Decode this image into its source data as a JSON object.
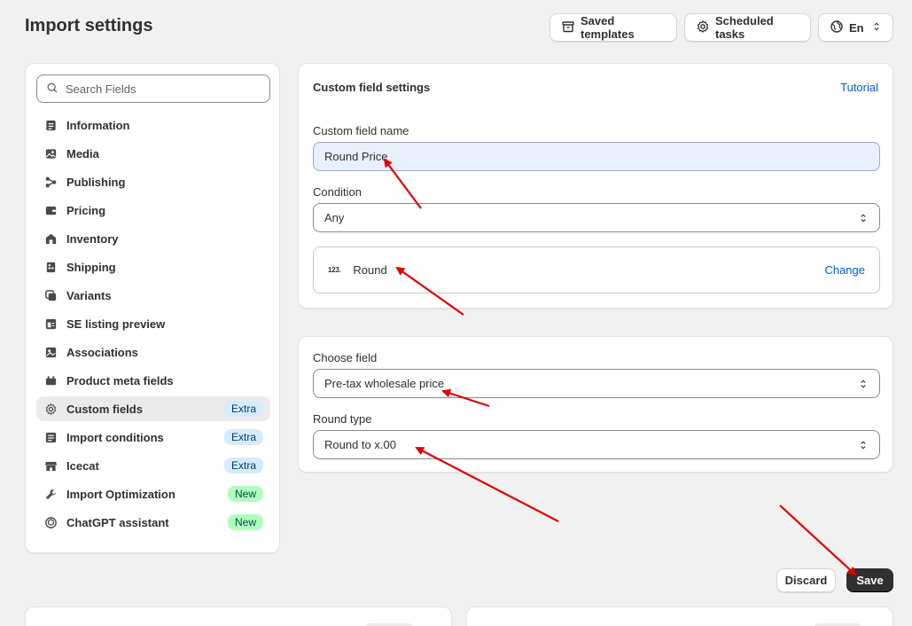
{
  "page": {
    "title": "Import settings"
  },
  "header": {
    "saved_templates": "Saved templates",
    "scheduled_tasks": "Scheduled tasks",
    "language": "En"
  },
  "sidebar": {
    "search_placeholder": "Search Fields",
    "items": [
      {
        "label": "Information",
        "icon": "document-icon",
        "badge": ""
      },
      {
        "label": "Media",
        "icon": "image-icon",
        "badge": ""
      },
      {
        "label": "Publishing",
        "icon": "publishing-icon",
        "badge": ""
      },
      {
        "label": "Pricing",
        "icon": "wallet-icon",
        "badge": ""
      },
      {
        "label": "Inventory",
        "icon": "inventory-icon",
        "badge": ""
      },
      {
        "label": "Shipping",
        "icon": "shipping-icon",
        "badge": ""
      },
      {
        "label": "Variants",
        "icon": "variants-icon",
        "badge": ""
      },
      {
        "label": "SE listing preview",
        "icon": "listing-preview-icon",
        "badge": ""
      },
      {
        "label": "Associations",
        "icon": "associations-icon",
        "badge": ""
      },
      {
        "label": "Product meta fields",
        "icon": "meta-fields-icon",
        "badge": ""
      },
      {
        "label": "Custom fields",
        "icon": "gear-icon",
        "badge": "Extra"
      },
      {
        "label": "Import conditions",
        "icon": "conditions-icon",
        "badge": "Extra"
      },
      {
        "label": "Icecat",
        "icon": "store-icon",
        "badge": "Extra"
      },
      {
        "label": "Import Optimization",
        "icon": "wrench-icon",
        "badge": "New"
      },
      {
        "label": "ChatGPT assistant",
        "icon": "chatgpt-icon",
        "badge": "New"
      }
    ]
  },
  "custom_field": {
    "title": "Custom field settings",
    "tutorial": "Tutorial",
    "name_label": "Custom field name",
    "name_value": "Round Price",
    "condition_label": "Condition",
    "condition_value": "Any",
    "function_icon_text": "123.",
    "function_name": "Round",
    "change": "Change"
  },
  "round_settings": {
    "choose_field_label": "Choose field",
    "choose_field_value": "Pre-tax wholesale price",
    "round_type_label": "Round type",
    "round_type_value": "Round to x.00"
  },
  "footer": {
    "discard": "Discard",
    "save": "Save"
  },
  "colors": {
    "accent_link": "#005bd3",
    "primary_button": "#303030",
    "annotation_arrow": "#e00000",
    "badge_extra": "#d5ebff",
    "badge_new": "#affebf"
  }
}
